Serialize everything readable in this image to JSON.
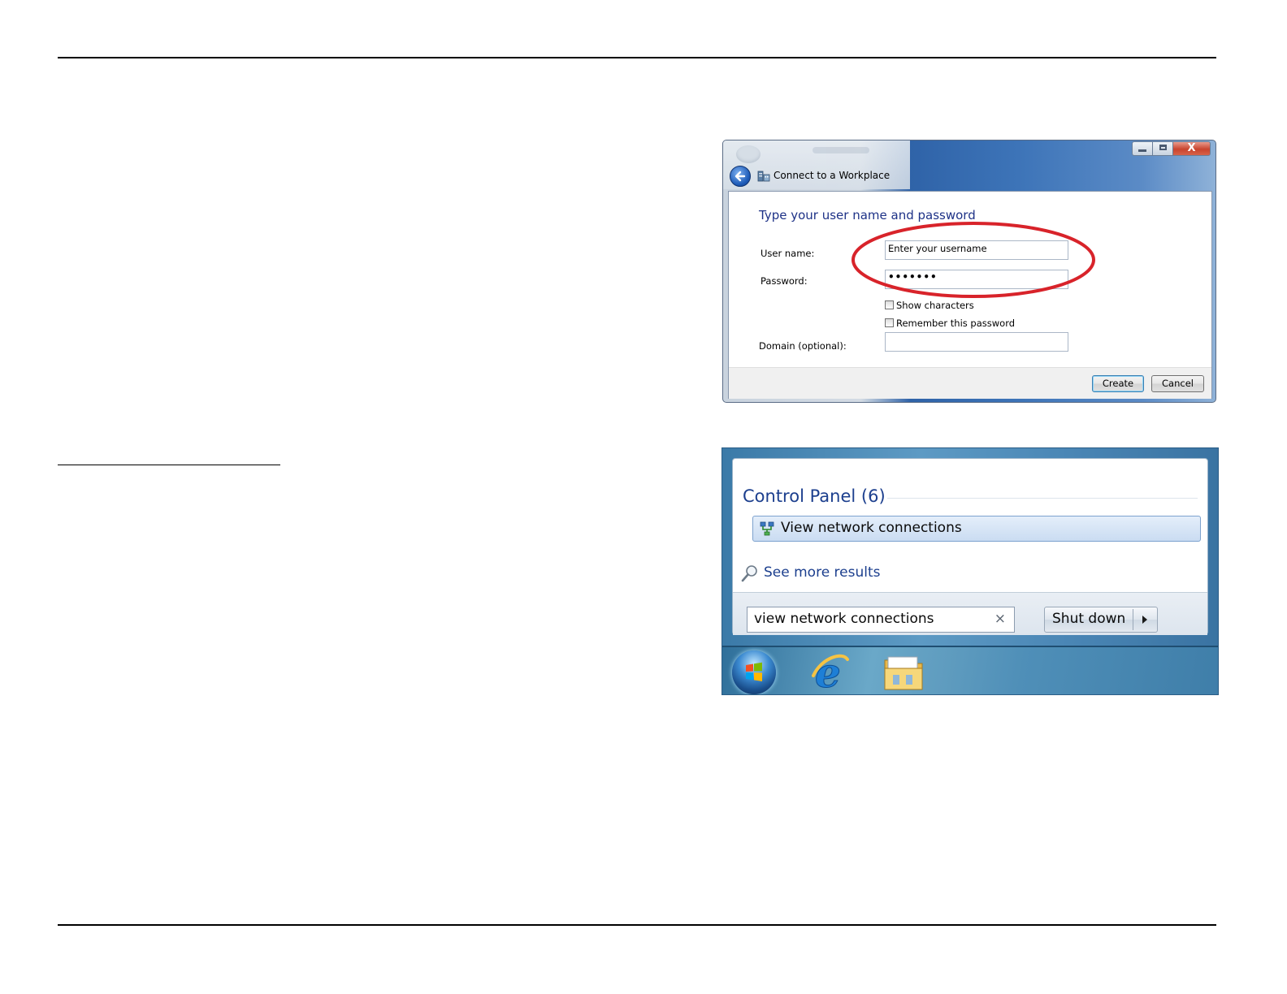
{
  "connect_dialog": {
    "window_title": "Connect to a Workplace",
    "close_glyph": "X",
    "heading": "Type your user name and password",
    "username_label": "User name:",
    "username_value": "Enter your username",
    "password_label": "Password:",
    "password_value": "•••••••",
    "show_characters_label": "Show characters",
    "remember_password_label": "Remember this password",
    "domain_label": "Domain (optional):",
    "domain_value": "",
    "create_label": "Create",
    "cancel_label": "Cancel",
    "highlight_color": "#d8232a"
  },
  "start_menu": {
    "group_heading": "Control Panel (6)",
    "result_item": "View network connections",
    "see_more": "See more results",
    "search_value": "view network connections",
    "clear_glyph": "×",
    "shutdown_label": "Shut down"
  },
  "taskbar": {
    "items": [
      "start-orb",
      "internet-explorer-icon",
      "windows-explorer-icon"
    ]
  }
}
